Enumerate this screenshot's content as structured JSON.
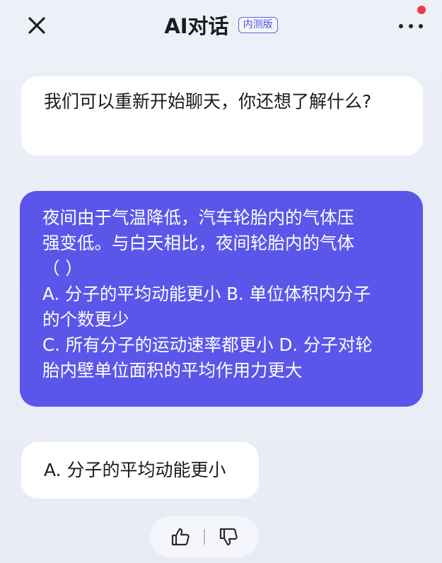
{
  "header": {
    "title": "AI对话",
    "badge": "内测版",
    "close_icon": "close-icon",
    "more_icon": "more-horizontal-icon",
    "notification_color": "#f23a4a"
  },
  "messages": [
    {
      "role": "assistant",
      "text": "我们可以重新开始聊天，你还想了解什么?"
    },
    {
      "role": "user",
      "lines": [
        "夜间由于气温降低，汽车轮胎内的气体压",
        "强变低。与白天相比，夜间轮胎内的气体",
        "（    ）",
        "A. 分子的平均动能更小 B. 单位体积内分子",
        "的个数更少",
        "C. 所有分子的运动速率都更小  D. 分子对轮",
        "胎内壁单位面积的平均作用力更大"
      ]
    },
    {
      "role": "assistant",
      "text": "A. 分子的平均动能更小"
    }
  ],
  "feedback": {
    "like_icon": "thumbs-up-icon",
    "dislike_icon": "thumbs-down-icon"
  },
  "colors": {
    "user_bubble": "#5a56ea",
    "assistant_bubble": "#ffffff",
    "accent": "#4a55d8"
  }
}
